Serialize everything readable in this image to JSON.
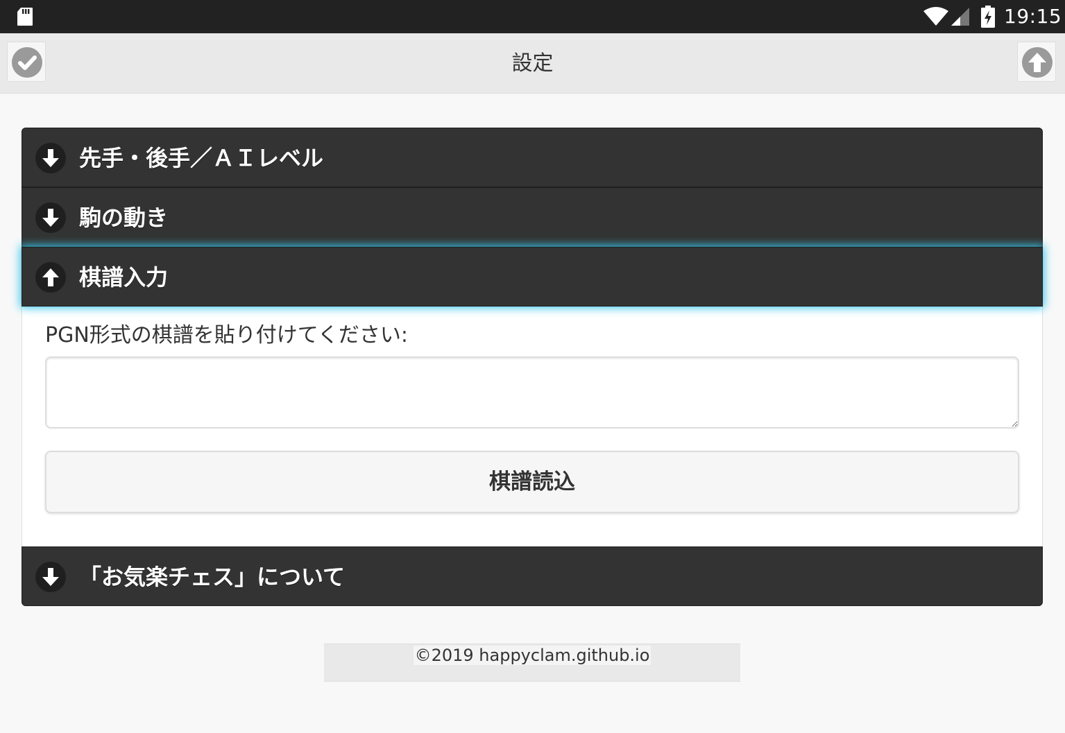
{
  "status_bar": {
    "time": "19:15",
    "icons": [
      "sd-card-icon",
      "wifi-icon",
      "signal-icon",
      "battery-charging-icon"
    ]
  },
  "header": {
    "title": "設定",
    "left_button_icon": "check-icon",
    "right_button_icon": "arrow-up-icon"
  },
  "sections": [
    {
      "label": "先手・後手／ＡＩレベル",
      "expanded": false,
      "icon": "arrow-down-icon"
    },
    {
      "label": "駒の動き",
      "expanded": false,
      "icon": "arrow-down-icon"
    },
    {
      "label": "棋譜入力",
      "expanded": true,
      "icon": "arrow-up-icon"
    },
    {
      "label": "「お気楽チェス」について",
      "expanded": false,
      "icon": "arrow-down-icon"
    }
  ],
  "kifu_input": {
    "prompt": "PGN形式の棋譜を貼り付けてください:",
    "textarea_value": "",
    "load_button_label": "棋譜読込"
  },
  "footer": {
    "copyright": "©2019 happyclam.github.io"
  },
  "colors": {
    "status_bar_bg": "#222222",
    "header_bg": "#e9e9e9",
    "collapsible_bg": "#333333",
    "active_glow": "#38c8ec",
    "page_bg": "#f8f8f8"
  }
}
